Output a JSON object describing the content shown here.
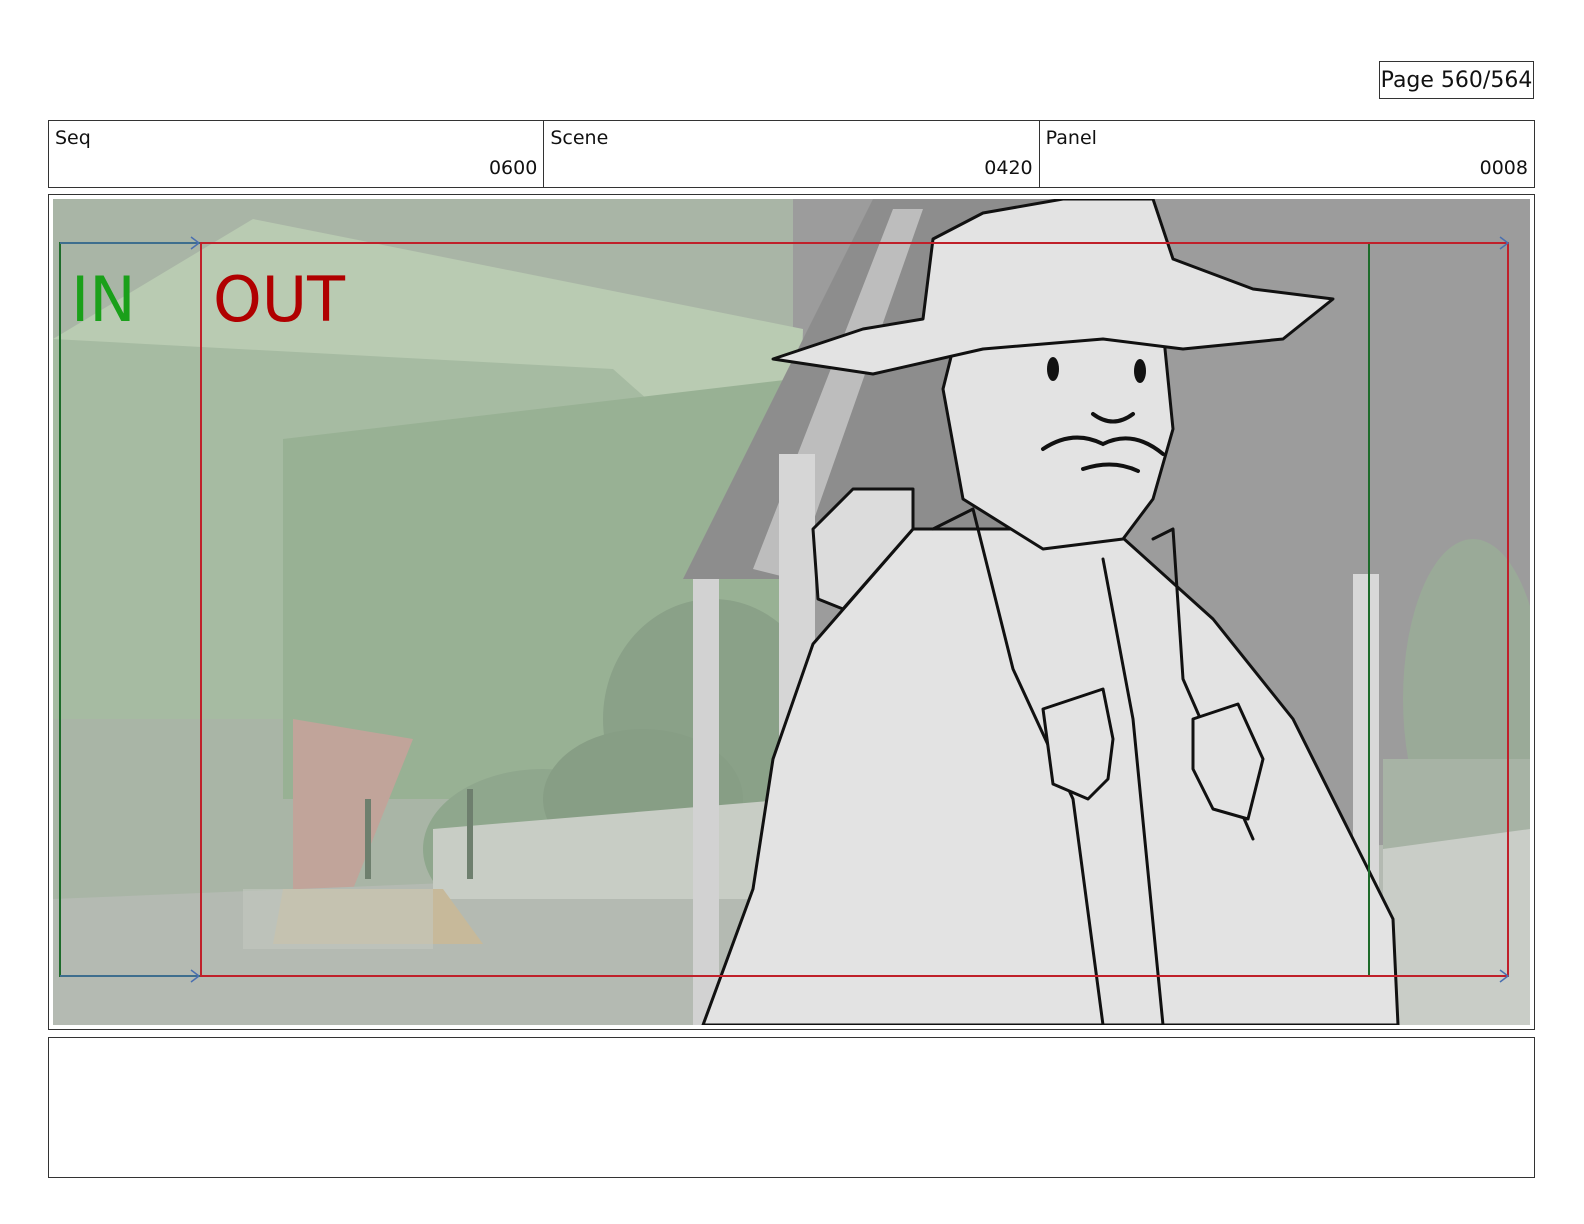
{
  "page": {
    "label": "Page 560/564"
  },
  "header": {
    "seq": {
      "label": "Seq",
      "value": "0600"
    },
    "scene": {
      "label": "Scene",
      "value": "0420"
    },
    "panel": {
      "label": "Panel",
      "value": "0008"
    }
  },
  "panel_overlay": {
    "in_label": "IN",
    "out_label": "OUT",
    "in_color": "#1aa01a",
    "out_color": "#b00000",
    "in_frame_color": "#1d6b2a",
    "out_frame_color": "#c0202a",
    "motion_arrow_color": "#4a6fb0"
  },
  "notes": {
    "text": ""
  }
}
